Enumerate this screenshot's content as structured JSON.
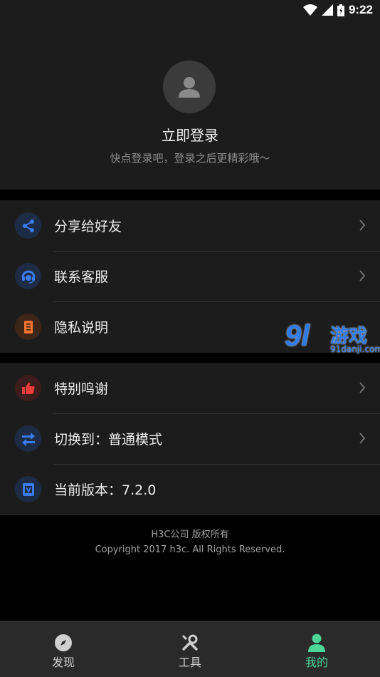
{
  "status_bar": {
    "time": "9:22"
  },
  "profile": {
    "title": "立即登录",
    "subtitle": "快点登录吧，登录之后更精彩哦～"
  },
  "menu_group_1": [
    {
      "label": "分享给好友",
      "icon": "share-icon",
      "color": "#2f6de0"
    },
    {
      "label": "联系客服",
      "icon": "customer-service-icon",
      "color": "#2f6de0"
    },
    {
      "label": "隐私说明",
      "icon": "document-icon",
      "color": "#f06a2a"
    }
  ],
  "menu_group_2": [
    {
      "label": "特别鸣谢",
      "icon": "thumbs-up-icon",
      "color": "#e63a3a"
    },
    {
      "label": "切换到：普通模式",
      "icon": "switch-icon",
      "color": "#2f6de0"
    },
    {
      "label": "当前版本：7.2.0",
      "icon": "version-icon",
      "color": "#2f6de0"
    }
  ],
  "footer": {
    "line1": "H3C公司 版权所有",
    "line2": "Copyright 2017 h3c. All Rights Reserved."
  },
  "watermark": {
    "mark": "9l",
    "text": "游戏",
    "domain": "91danji.com"
  },
  "bottom_nav": [
    {
      "label": "发现",
      "icon": "compass-icon"
    },
    {
      "label": "工具",
      "icon": "tools-icon"
    },
    {
      "label": "我的",
      "icon": "user-icon",
      "active": true
    }
  ],
  "colors": {
    "accent": "#4cd69a",
    "background": "#000000",
    "card": "#1c1c1c"
  }
}
